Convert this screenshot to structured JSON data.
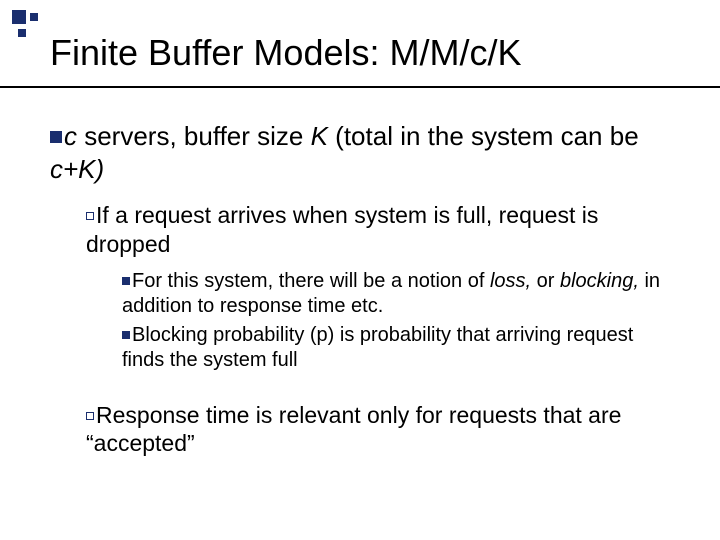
{
  "title": "Finite Buffer Models: M/M/c/K",
  "l1": {
    "pre": "c",
    "mid": " servers, buffer size ",
    "k": "K",
    "post1": "  (total in the system can be ",
    "cik": "c+K)"
  },
  "l2a": "If a request arrives when system is full, request is dropped",
  "l3a": {
    "pre": "For this system, there will be a notion of ",
    "loss": "loss,",
    "or": " or ",
    "blocking": "blocking,",
    "post": " in addition to response time etc."
  },
  "l3b": "Blocking probability (p) is probability that arriving request finds the system full",
  "l2b": "Response time is relevant only for requests that are “accepted”"
}
